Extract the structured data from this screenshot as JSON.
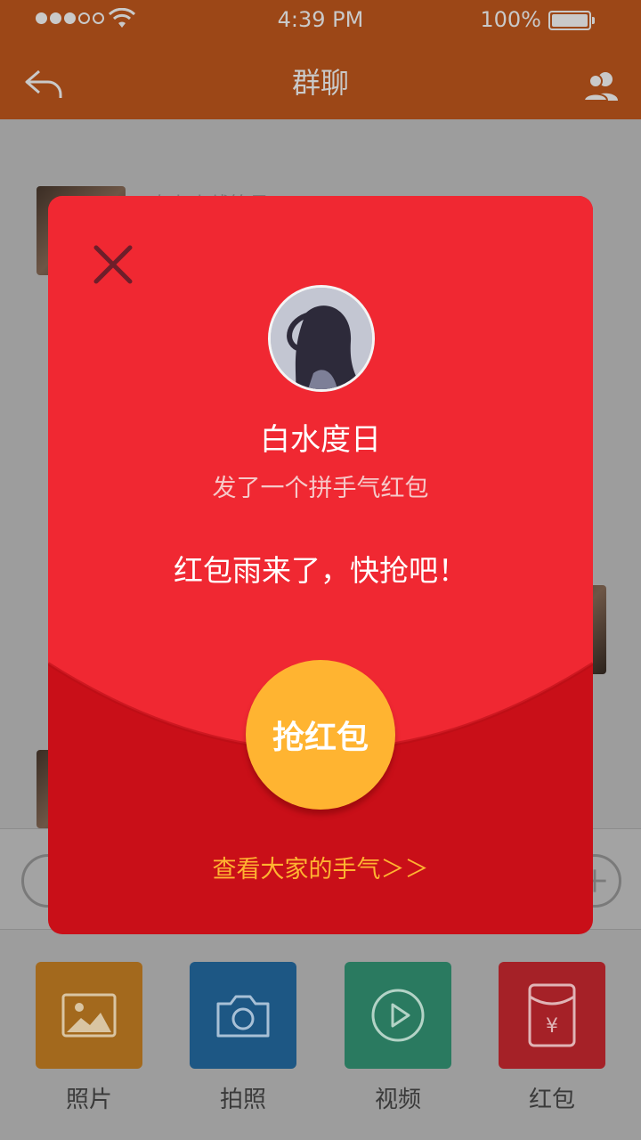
{
  "status_bar": {
    "time": "4:39 PM",
    "battery": "100%",
    "signal_dots_filled": 3,
    "signal_dots_total": 5
  },
  "nav": {
    "title": "群聊",
    "back_icon": "back-arrow-icon",
    "members_icon": "group-members-icon"
  },
  "chat": {
    "partial_text": "在七上线等易"
  },
  "red_packet": {
    "sender_name": "白水度日",
    "subtitle": "发了一个拼手气红包",
    "message": "红包雨来了，快抢吧！",
    "grab_label": "抢红包",
    "view_luck_label": "查看大家的手气＞＞",
    "colors": {
      "top": "#f02832",
      "bottom": "#c90f18",
      "button": "#ffb431"
    }
  },
  "tools": [
    {
      "label": "照片",
      "icon": "picture-icon",
      "color": "#a3691d"
    },
    {
      "label": "拍照",
      "icon": "camera-icon",
      "color": "#1d5784"
    },
    {
      "label": "视频",
      "icon": "video-play-icon",
      "color": "#2a7a60"
    },
    {
      "label": "红包",
      "icon": "red-envelope-icon",
      "color": "#a52127"
    }
  ]
}
